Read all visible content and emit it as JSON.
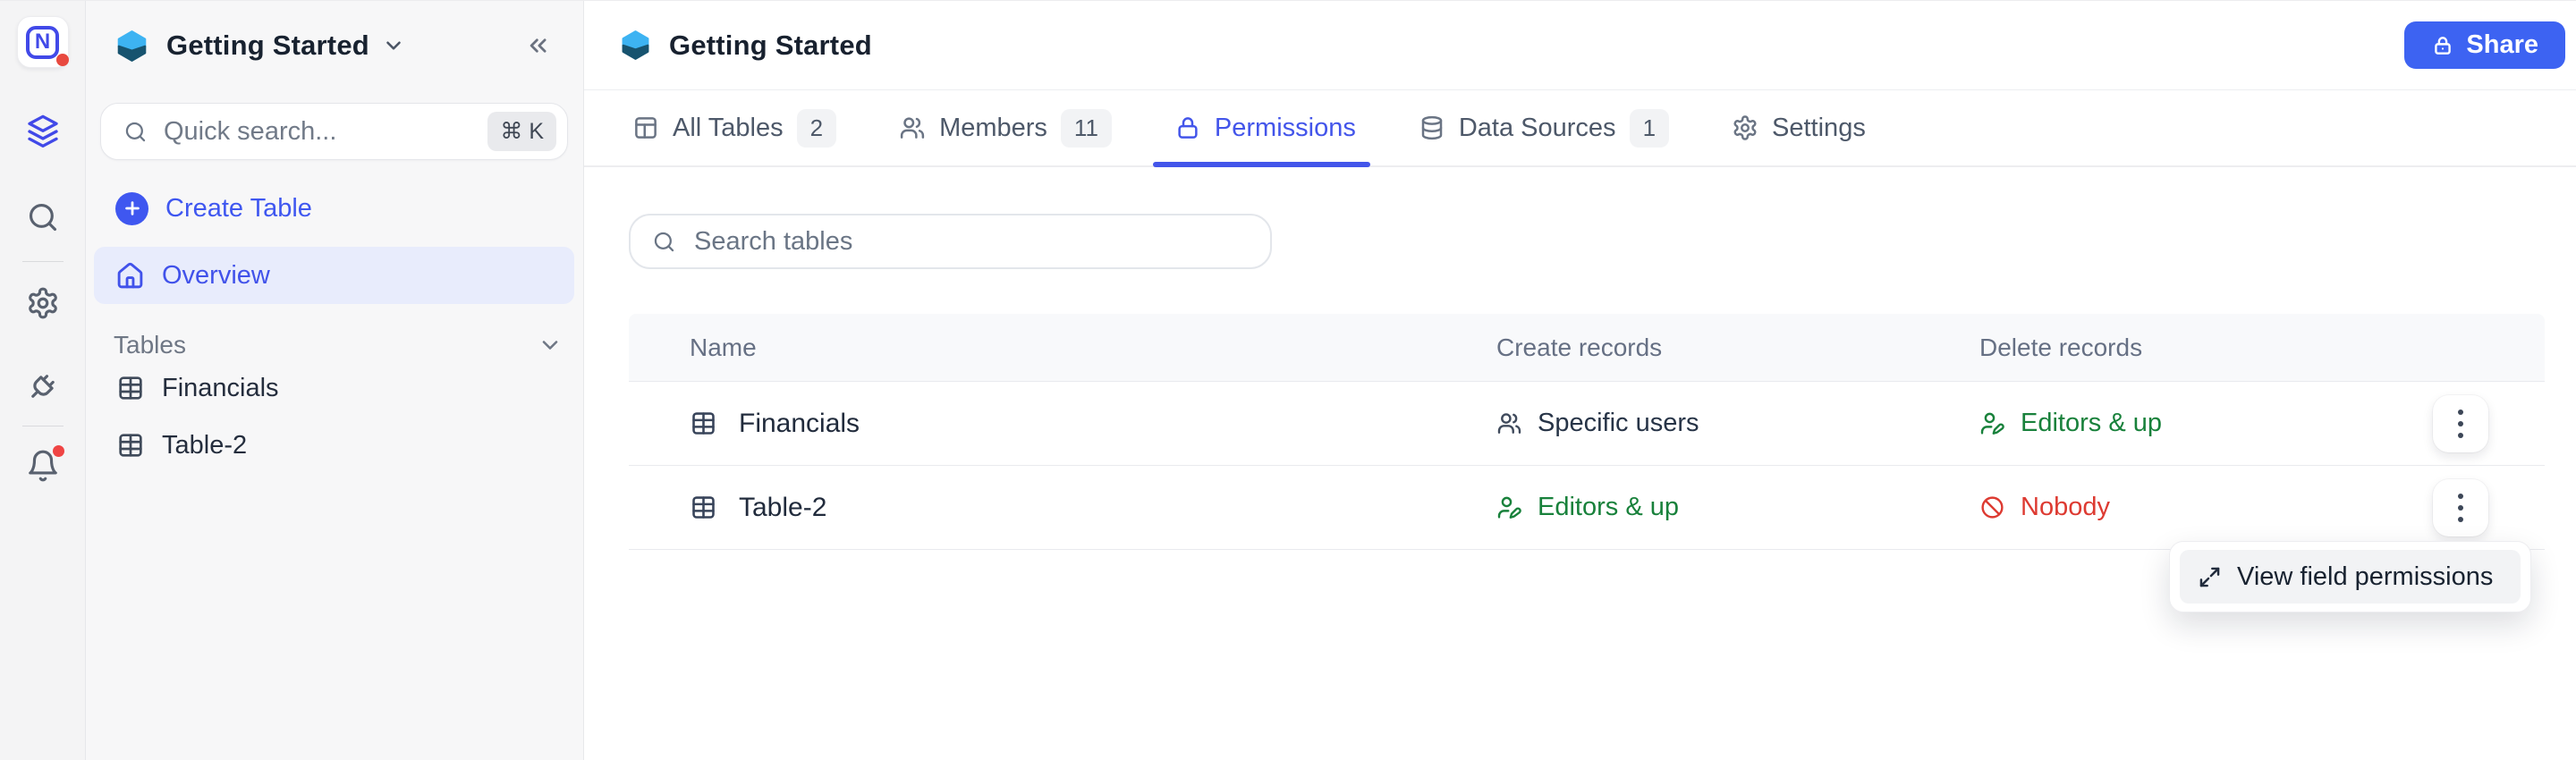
{
  "app": {
    "logo_letter": "N"
  },
  "rail": {
    "icons": [
      "n-logo",
      "layers-icon",
      "search-icon",
      "gear-icon",
      "plug-icon",
      "bell-icon"
    ],
    "notifications": {
      "logo_dot": true,
      "bell_dot": true
    }
  },
  "sidebar": {
    "workspace": "Getting Started",
    "search": {
      "placeholder": "Quick search...",
      "shortcut": "⌘ K"
    },
    "create_table_label": "Create Table",
    "overview_label": "Overview",
    "tables_section_label": "Tables",
    "tables": [
      {
        "name": "Financials"
      },
      {
        "name": "Table-2"
      }
    ]
  },
  "header": {
    "title": "Getting Started",
    "share_label": "Share"
  },
  "tabs": [
    {
      "label": "All Tables",
      "badge": "2",
      "icon": "panels-icon",
      "active": false
    },
    {
      "label": "Members",
      "badge": "11",
      "icon": "users-icon",
      "active": false
    },
    {
      "label": "Permissions",
      "badge": "",
      "icon": "lock-icon",
      "active": true
    },
    {
      "label": "Data Sources",
      "badge": "1",
      "icon": "database-icon",
      "active": false
    },
    {
      "label": "Settings",
      "badge": "",
      "icon": "gear-icon",
      "active": false
    }
  ],
  "content": {
    "search_placeholder": "Search tables",
    "columns": [
      "Name",
      "Create records",
      "Delete records"
    ],
    "rows": [
      {
        "name": "Financials",
        "create": {
          "label": "Specific users",
          "type": "neutral",
          "icon": "users-icon"
        },
        "delete": {
          "label": "Editors & up",
          "type": "positive",
          "icon": "user-pen-icon"
        }
      },
      {
        "name": "Table-2",
        "create": {
          "label": "Editors & up",
          "type": "positive",
          "icon": "user-pen-icon"
        },
        "delete": {
          "label": "Nobody",
          "type": "negative",
          "icon": "ban-icon"
        }
      }
    ]
  },
  "menu": {
    "item_label": "View field permissions",
    "item_icon": "expand-icon"
  },
  "colors": {
    "accent": "#4355ea",
    "share_button": "#3d63f2",
    "positive": "#18813b",
    "negative": "#dd3a31",
    "overview_bg": "#e8ecfc",
    "notification_dot": "#ef4444"
  }
}
